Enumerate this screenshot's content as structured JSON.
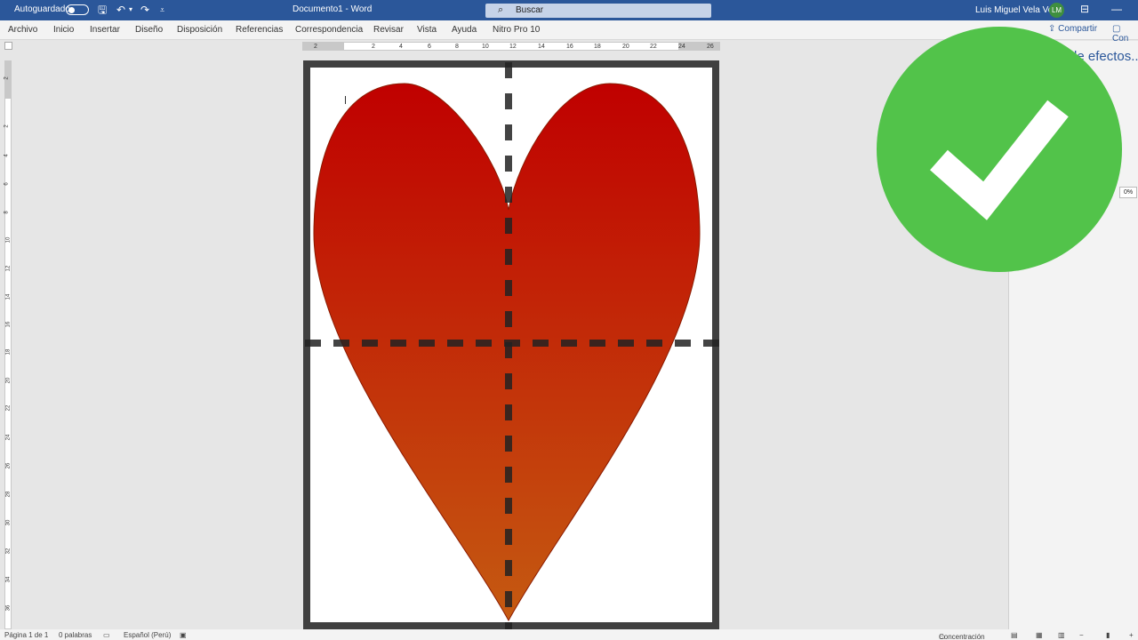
{
  "titlebar": {
    "autosave_label": "Autoguardado",
    "doc_title": "Documento1  -  Word",
    "search_placeholder": "Buscar",
    "user_name": "Luis Miguel Vela Vela",
    "user_initials": "LM"
  },
  "ribbon": {
    "tabs": [
      "Archivo",
      "Inicio",
      "Insertar",
      "Diseño",
      "Disposición",
      "Referencias",
      "Correspondencia",
      "Revisar",
      "Vista",
      "Ayuda",
      "Nitro Pro 10"
    ],
    "share_label": "Compartir",
    "comments_label": "Con"
  },
  "ruler": {
    "h_numbers": [
      "2",
      "2",
      "4",
      "6",
      "8",
      "10",
      "12",
      "14",
      "16",
      "18",
      "20",
      "22",
      "24",
      "26"
    ],
    "v_numbers": [
      "2",
      "2",
      "4",
      "6",
      "8",
      "10",
      "12",
      "14",
      "16",
      "18",
      "20",
      "22",
      "24",
      "26",
      "28",
      "30",
      "32",
      "34",
      "36"
    ]
  },
  "pane": {
    "title": "de efectos..",
    "percent": "0%"
  },
  "status": {
    "page": "Página 1 de 1",
    "words": "0 palabras",
    "language": "Español (Perú)",
    "focus": "Concentración"
  },
  "colors": {
    "brand": "#2b579a",
    "check_green": "#52c34a",
    "heart_top": "#c00000",
    "heart_bottom": "#c55a11",
    "frame": "#404040"
  },
  "icons": [
    "save-icon",
    "undo-icon",
    "redo-icon",
    "customize-icon",
    "search-icon",
    "ribbon-display-icon",
    "minimize-icon",
    "share-icon",
    "comment-icon",
    "checkmark-icon",
    "heart-shape"
  ]
}
